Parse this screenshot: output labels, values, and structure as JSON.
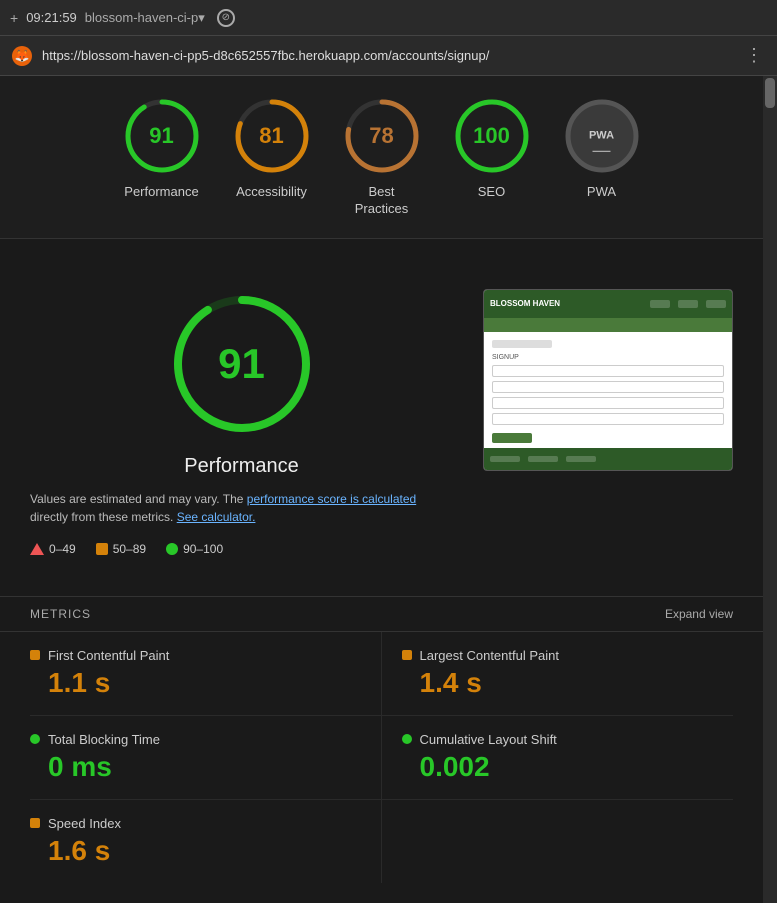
{
  "topbar": {
    "time": "09:21:59",
    "site": "blossom-haven-ci-p▾",
    "icon": "+"
  },
  "urlbar": {
    "url": "https://blossom-haven-ci-pp5-d8c652557fbc.herokuapp.com/accounts/signup/",
    "favicon": "🦊",
    "more": "⋮"
  },
  "scores": [
    {
      "id": "performance",
      "value": "91",
      "label": "Performance",
      "color": "#28c728",
      "ring_color": "#28c728",
      "bg_color": "#1e1e1e",
      "circumference": 220,
      "dash": 200
    },
    {
      "id": "accessibility",
      "value": "81",
      "label": "Accessibility",
      "color": "#d4820a",
      "ring_color": "#d4820a",
      "circumference": 220,
      "dash": 181
    },
    {
      "id": "best-practices",
      "value": "78",
      "label": "Best Practices",
      "color": "#d4820a",
      "ring_color": "#d4820a",
      "circumference": 220,
      "dash": 171
    },
    {
      "id": "seo",
      "value": "100",
      "label": "SEO",
      "color": "#28c728",
      "ring_color": "#28c728",
      "circumference": 220,
      "dash": 220
    },
    {
      "id": "pwa",
      "value": "—",
      "label": "PWA",
      "color": "#aaa",
      "ring_color": "#555",
      "circumference": 220,
      "dash": 0
    }
  ],
  "big_score": {
    "value": "91",
    "label": "Performance"
  },
  "description": {
    "text_before": "Values are estimated and may vary. The ",
    "link1_text": "performance score is calculated",
    "text_middle": " directly from these metrics. ",
    "link2_text": "See calculator."
  },
  "legend": [
    {
      "id": "red",
      "range": "0–49",
      "shape": "triangle"
    },
    {
      "id": "orange",
      "range": "50–89",
      "shape": "square"
    },
    {
      "id": "green",
      "range": "90–100",
      "shape": "circle"
    }
  ],
  "metrics_header": {
    "title": "METRICS",
    "expand_label": "Expand view"
  },
  "metrics": [
    {
      "id": "fcp",
      "label": "First Contentful Paint",
      "value": "1.1 s",
      "color": "orange"
    },
    {
      "id": "lcp",
      "label": "Largest Contentful Paint",
      "value": "1.4 s",
      "color": "orange"
    },
    {
      "id": "tbt",
      "label": "Total Blocking Time",
      "value": "0 ms",
      "color": "green"
    },
    {
      "id": "cls",
      "label": "Cumulative Layout Shift",
      "value": "0.002",
      "color": "green"
    },
    {
      "id": "si",
      "label": "Speed Index",
      "value": "1.6 s",
      "color": "orange"
    }
  ]
}
